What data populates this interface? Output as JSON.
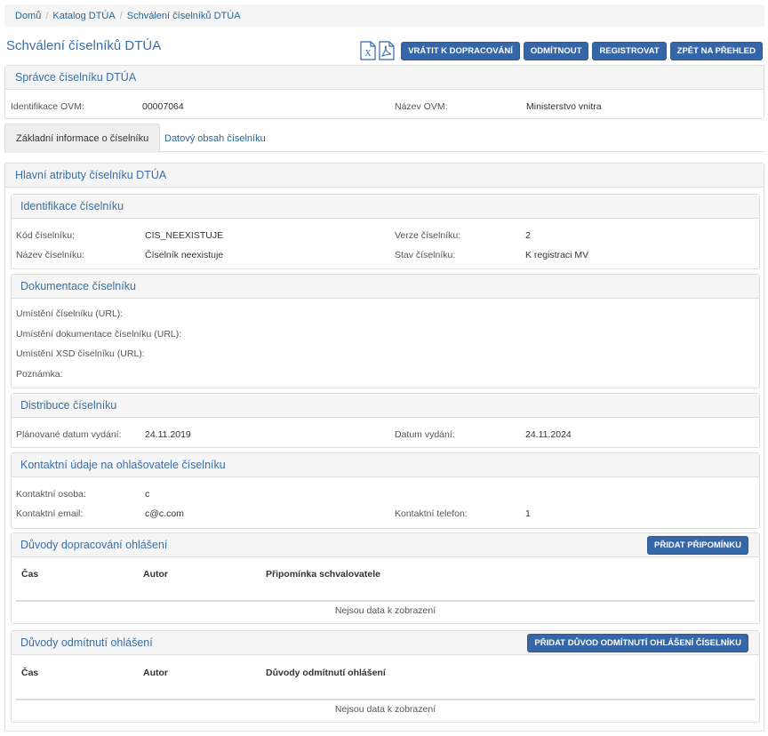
{
  "breadcrumb": [
    "Domů",
    "Katalog DTÚA",
    "Schválení číselníků DTÚA"
  ],
  "page_title": "Schválení číselníků DTÚA",
  "toolbar": {
    "export_excel_icon": "excel-icon",
    "export_pdf_icon": "pdf-icon",
    "return_label": "VRÁTIT K DOPRACOVÁNÍ",
    "reject_label": "ODMÍTNOUT",
    "register_label": "REGISTROVAT",
    "back_label": "ZPĚT NA PŘEHLED",
    "button_color": "#3466a8"
  },
  "admin": {
    "title": "Správce číselníku DTÚA",
    "ovm_id_label": "Identifikace OVM:",
    "ovm_id_value": "00007064",
    "ovm_name_label": "Název OVM:",
    "ovm_name_value": "Ministerstvo vnitra"
  },
  "tabs": [
    {
      "label": "Základní informace o číselníku",
      "active": true
    },
    {
      "label": "Datový obsah číselníku",
      "active": false
    }
  ],
  "main": {
    "title": "Hlavní atributy číselníku DTÚA",
    "identification": {
      "title": "Identifikace číselníku",
      "code_label": "Kód číselníku:",
      "code_value": "CIS_NEEXISTUJE",
      "version_label": "Verze číselníku:",
      "version_value": "2",
      "name_label": "Název číselníku:",
      "name_value": "Číselník neexistuje",
      "state_label": "Stav číselníku:",
      "state_value": "K registraci MV"
    },
    "documentation": {
      "title": "Dokumentace číselníku",
      "url_label": "Umístění číselníku (URL):",
      "doc_url_label": "Umístění dokumentace číselníku (URL):",
      "xsd_url_label": "Umístění XSD číselníku (URL):",
      "note_label": "Poznámka:"
    },
    "distribution": {
      "title": "Distribuce číselníku",
      "planned_label": "Plánované datum vydání:",
      "planned_value": "24.11.2019",
      "release_label": "Datum vydání:",
      "release_value": "24.11.2024"
    },
    "contact": {
      "title": "Kontaktní údaje na ohlašovatele číselníku",
      "person_label": "Kontaktní osoba:",
      "person_value": "c",
      "email_label": "Kontaktní email:",
      "email_value": "c@c.com",
      "phone_label": "Kontaktní telefon:",
      "phone_value": "1"
    },
    "rework": {
      "title": "Důvody dopracování ohlášení",
      "button_label": "PŘIDAT PŘIPOMÍNKU",
      "columns": [
        "Čas",
        "Autor",
        "Připomínka schvalovatele"
      ],
      "empty": "Nejsou data k zobrazení"
    },
    "rejection": {
      "title": "Důvody odmítnutí ohlášení",
      "button_label": "PŘIDAT DŮVOD ODMÍTNUTÍ OHLÁŠENÍ ČÍSELNÍKU",
      "columns": [
        "Čas",
        "Autor",
        "Důvody odmítnutí ohlášení"
      ],
      "empty": "Nejsou data k zobrazení"
    }
  }
}
